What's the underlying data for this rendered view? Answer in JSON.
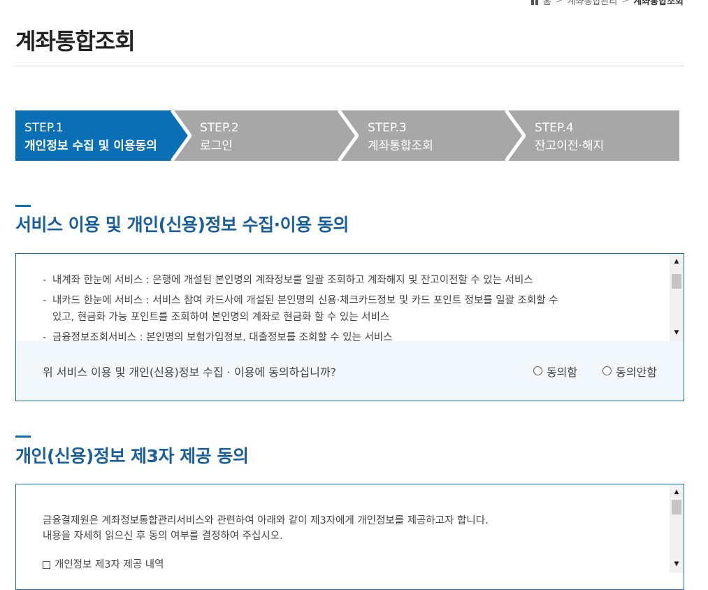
{
  "breadcrumb": {
    "home": "홈",
    "level1": "계좌통합관리",
    "current": "계좌통합조회",
    "sep": ">"
  },
  "page": {
    "title": "계좌통합조회"
  },
  "steps": [
    {
      "num": "STEP.1",
      "name": "개인정보 수집 및 이용동의"
    },
    {
      "num": "STEP.2",
      "name": "로그인"
    },
    {
      "num": "STEP.3",
      "name": "계좌통합조회"
    },
    {
      "num": "STEP.4",
      "name": "잔고이전·해지"
    }
  ],
  "section1": {
    "title": "서비스 이용 및 개인(신용)정보 수집·이용 동의",
    "terms": [
      {
        "line1": "내계좌 한눈에 서비스 : 은행에 개설된 본인명의 계좌정보를 일괄 조회하고 계좌해지 및 잔고이전할 수 있는 서비스",
        "line2": ""
      },
      {
        "line1": "내카드 한눈에 서비스 : 서비스 참여 카드사에 개설된 본인명의 신용·체크카드정보 및 카드 포인트 정보를 일괄 조회할 수",
        "line2": "있고, 현금화 가능 포인트를 조회하여 본인명의 계좌로 현금화 할 수 있는 서비스"
      },
      {
        "line1": "금융정보조회서비스 : 본인명의 보험가입정보, 대출정보를 조회할 수 있는 서비스",
        "line2": ""
      }
    ],
    "question": "위 서비스 이용 및 개인(신용)정보 수집 · 이용에 동의하십니까?",
    "agree_label": "동의함",
    "disagree_label": "동의안함"
  },
  "section2": {
    "title": "개인(신용)정보 제3자 제공 동의",
    "para_line1": "금융결제원은 계좌정보통합관리서비스와 관련하여 아래와 같이 제3자에게 개인정보를 제공하고자 합니다.",
    "para_line2": "내용을 자세히 읽으신 후 동의 여부를 결정하여 주십시오.",
    "item": "개인정보 제3자 제공 내역"
  },
  "colors": {
    "accent": "#0b6fb6",
    "step_inactive": "#a7a7a7",
    "section_title": "#1a5e9c",
    "agree_bg": "#f1f7fb"
  },
  "icons": [
    "home-icon",
    "chevron-right-icon",
    "scroll-up-arrow-icon",
    "scroll-down-arrow-icon",
    "radio-icon",
    "checkbox-icon"
  ]
}
